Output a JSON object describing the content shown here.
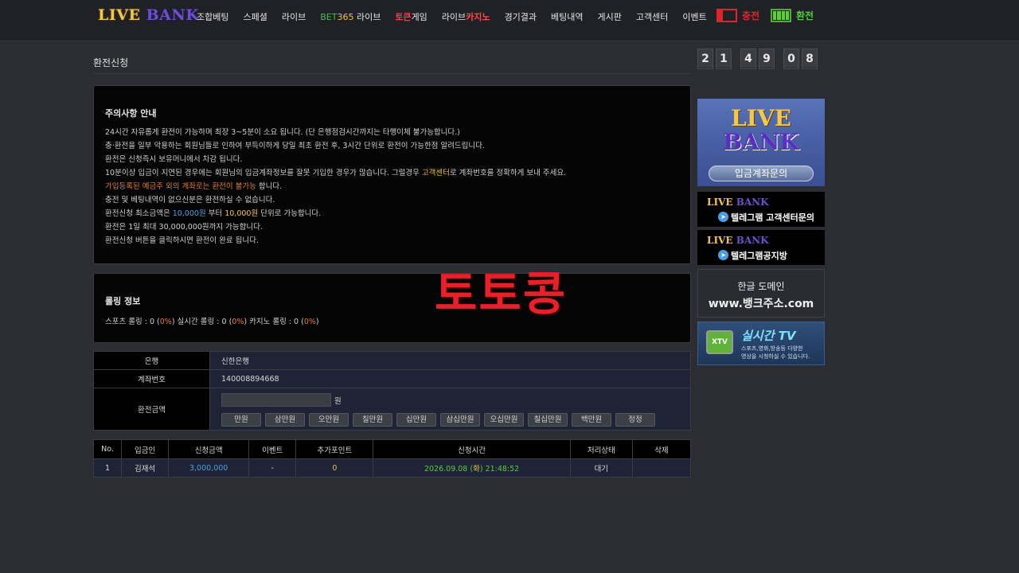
{
  "header": {
    "logo_part1": "LIVE ",
    "logo_part2": "BANK",
    "nav": {
      "combo_betting": "조합베팅",
      "special": "스페셜",
      "live": "라이브",
      "bet365_bet": "BET",
      "bet365_num": "365",
      "bet365_suffix": " 라이브",
      "token_a": "토큰",
      "token_b": "게임",
      "live_casino_a": "라이브",
      "live_casino_b": "카지노",
      "results": "경기결과",
      "bet_history": "베팅내역",
      "board": "게시판",
      "support": "고객센터",
      "event": "이벤트"
    },
    "charge_label": "충전",
    "exchange_label": "환전"
  },
  "page_title": "환전신청",
  "clock": [
    "2",
    "1",
    "4",
    "9",
    "0",
    "8"
  ],
  "notice": {
    "title": "주의사항 안내",
    "line1": "24시간 자유롭게 환전이 가능하며 최장 3~5분이 소요 됩니다. (단 은행점검시간까지는 타행이체 불가능합니다.)",
    "line2": "충·환전을 일부 악용하는 회원님들로 인하여 부득이하게 당일 최초 환전 후, 3시간 단위로 환전이 가능한점 알려드립니다.",
    "line3": "환전은 신청즉시 보유머니에서 차감 됩니다.",
    "line4_a": "10분이상 입금이 지연된 경우에는 회원님의 입금계좌정보를 잘못 기입한 경우가 많습니다. 그럴경우 ",
    "line4_b": "고객센터",
    "line4_c": "로 계좌번호를 정확하게 보내 주세요.",
    "line5_a": "가입등록된 예금주 외의 계좌로는 환전이 불가능",
    "line5_b": " 합니다.",
    "line6": "충전 및 베팅내역이 없으신분은 환전하실 수 없습니다.",
    "line7_a": "환전신청 최소금액은 ",
    "line7_b": "10,000원",
    "line7_c": " 부터 ",
    "line7_d": "10,000원",
    "line7_e": " 단위로 가능합니다.",
    "line8": "환전은 1일 최대 30,000,000원까지 가능합니다.",
    "line9": "환전신청 버튼을 클릭하시면 환전이 완료 됩니다."
  },
  "rolling": {
    "title": "롤링 정보",
    "sports_label": "스포츠 롤링 : 0 (",
    "sports_pct": "0%",
    "live_label": ") 실시간 롤링 : 0 (",
    "live_pct": "0%",
    "casino_label": ") 카지노 롤링 : 0 (",
    "casino_pct": "0%",
    "close": ")"
  },
  "watermark": "토토콩",
  "form": {
    "bank_label": "은행",
    "bank_value": "신한은행",
    "account_label": "계좌번호",
    "account_value": "140008894668",
    "amount_label": "환전금액",
    "amount_value": "",
    "won": "원",
    "buttons": [
      "만원",
      "삼만원",
      "오만원",
      "칠만원",
      "십만원",
      "삼십만원",
      "오십만원",
      "칠십만원",
      "백만원",
      "정정"
    ]
  },
  "history": {
    "headers": [
      "No.",
      "입금인",
      "신청금액",
      "이벤트",
      "추가포인트",
      "신청시간",
      "처리상태",
      "삭제"
    ],
    "row": {
      "no": "1",
      "depositor": "김재석",
      "amount": "3,000,000",
      "event": "-",
      "points": "0",
      "time_date": "2026.09.08 (",
      "time_day": "화",
      "time_clock": ") 21:48:52",
      "status": "대기",
      "delete": ""
    }
  },
  "banners": {
    "b1_line1": "LIVE",
    "b1_line2": "BANK",
    "b1_button": "입금계좌문의",
    "b2_logo_a": "LIVE ",
    "b2_logo_b": "BANK",
    "b2_text": "텔레그램 고객센터문의",
    "b3_logo_a": "LIVE ",
    "b3_logo_b": "BANK",
    "b3_text": "텔레그램공지방",
    "b4_line1": "한글 도메인",
    "b4_line2": "www.뱅크주소.com",
    "b5_icon": "XTV",
    "b5_title": "실시간 TV",
    "b5_desc1": "스포츠,영화,방송등 다양한",
    "b5_desc2": "영상을 시청하실 수 있습니다."
  }
}
